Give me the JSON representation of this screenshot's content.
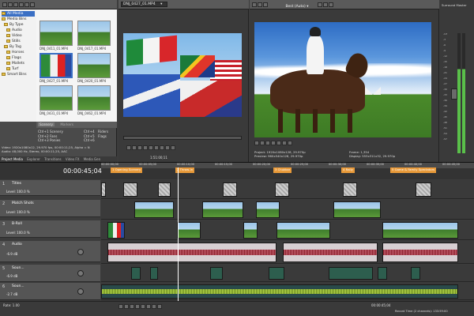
{
  "explorer": {
    "tree": [
      "All Media",
      "Media Bins",
      "By Type",
      "Audio",
      "Video",
      "Stills",
      "By Tag",
      "Horses",
      "Flags",
      "Mallets",
      "Turf",
      "Smart Bins"
    ],
    "thumbs": [
      {
        "name": "DNJ_0411_01.MP4"
      },
      {
        "name": "DNJ_0417_01.MP4"
      },
      {
        "name": "DNJ_0427_01.MP4"
      },
      {
        "name": "DNJ_0420_01.MP4"
      },
      {
        "name": "DNJ_0431_01.MP4"
      },
      {
        "name": "DNJ_0462_01.MP4"
      }
    ],
    "tabs": [
      "Scenery",
      "Markers"
    ],
    "shortcuts": [
      {
        "label": "Ctrl+1",
        "value": "Scenery",
        "key": "Ctrl+4",
        "value2": "Riders"
      },
      {
        "label": "Ctrl+2",
        "value": "Fans",
        "key": "Ctrl+5",
        "value2": "Flags"
      },
      {
        "label": "Ctrl+3",
        "value": "Ponies",
        "key": "Ctrl+6",
        "value2": ""
      }
    ],
    "info_line1": "Video: 1920x1080x12, 29.970 fps, 00:00:11;25, Alpha = N",
    "info_line2": "Audio: 48,000 Hz, Stereo, 00:00:11;25, AAC",
    "bottom_tabs": [
      "Project Media",
      "Explorer",
      "Transitions",
      "Video FX",
      "Media Gen"
    ]
  },
  "trimmer": {
    "file": "DNJ_0427_01.MP4",
    "time": "1:51:00;11"
  },
  "preview": {
    "tab": "[Polo_Match]",
    "mode": "Best (Auto)",
    "project_label": "Project:",
    "project": "1920x1080x128, 29.970p",
    "preview_label": "Preview:",
    "preview_value": "960x540x128, 29.970p",
    "frame_label": "Frame:",
    "frame": "1,354",
    "display_label": "Display:",
    "display": "553x311x32, 29.970p"
  },
  "master": {
    "label": "Surround Master",
    "scale": [
      "-Inf",
      "-3",
      "-6",
      "-9",
      "-12",
      "-15",
      "-18",
      "-21",
      "-24",
      "-27",
      "-30",
      "-33",
      "-36",
      "-39",
      "-42",
      "-45",
      "-48",
      "-51",
      "-54",
      "-57"
    ]
  },
  "timeline": {
    "current_time": "00:00:45;04",
    "ruler": [
      "00:00:00;00",
      "00:00:05;00",
      "00:00:10;00",
      "00:00:15;00",
      "00:00:20;00",
      "00:00:25;00",
      "00:00:30;00",
      "00:00:35;00",
      "00:00:40;00",
      "00:00:45;00"
    ],
    "markers": [
      {
        "num": "1",
        "label": "Opening Scenery"
      },
      {
        "num": "2",
        "label": "Throw-in"
      },
      {
        "num": "3",
        "label": "Chukkar"
      },
      {
        "num": "4",
        "label": "Rally"
      },
      {
        "num": "5",
        "label": "Game & Family Spectators"
      }
    ],
    "tracks": [
      {
        "num": "1",
        "name": "Titles",
        "level": "Level: 100.0 %"
      },
      {
        "num": "2",
        "name": "Match Shots",
        "level": "Level: 100.0 %"
      },
      {
        "num": "3",
        "name": "B-Roll",
        "level": "Level: 100.0 %"
      },
      {
        "num": "4",
        "name": "Audio",
        "vol": "-6.9 dB",
        "pan": "Center"
      },
      {
        "num": "5",
        "name": "Soun...",
        "vol": "-6.9 dB",
        "pan": "Center"
      },
      {
        "num": "6",
        "name": "Soun...",
        "vol": "-2.7 dB",
        "pan": "Center"
      }
    ],
    "rate": "Rate: 1.00",
    "status_time": "00:00:45;04",
    "record_time": "Record Time (2 channels): 133:59:00"
  },
  "colors": {
    "accent": "#3a6fc4",
    "marker": "#e89a3a",
    "audio_wave": "#8a1f2a",
    "sound_wave": "#b5d84a",
    "meter": "#5ac04a"
  }
}
